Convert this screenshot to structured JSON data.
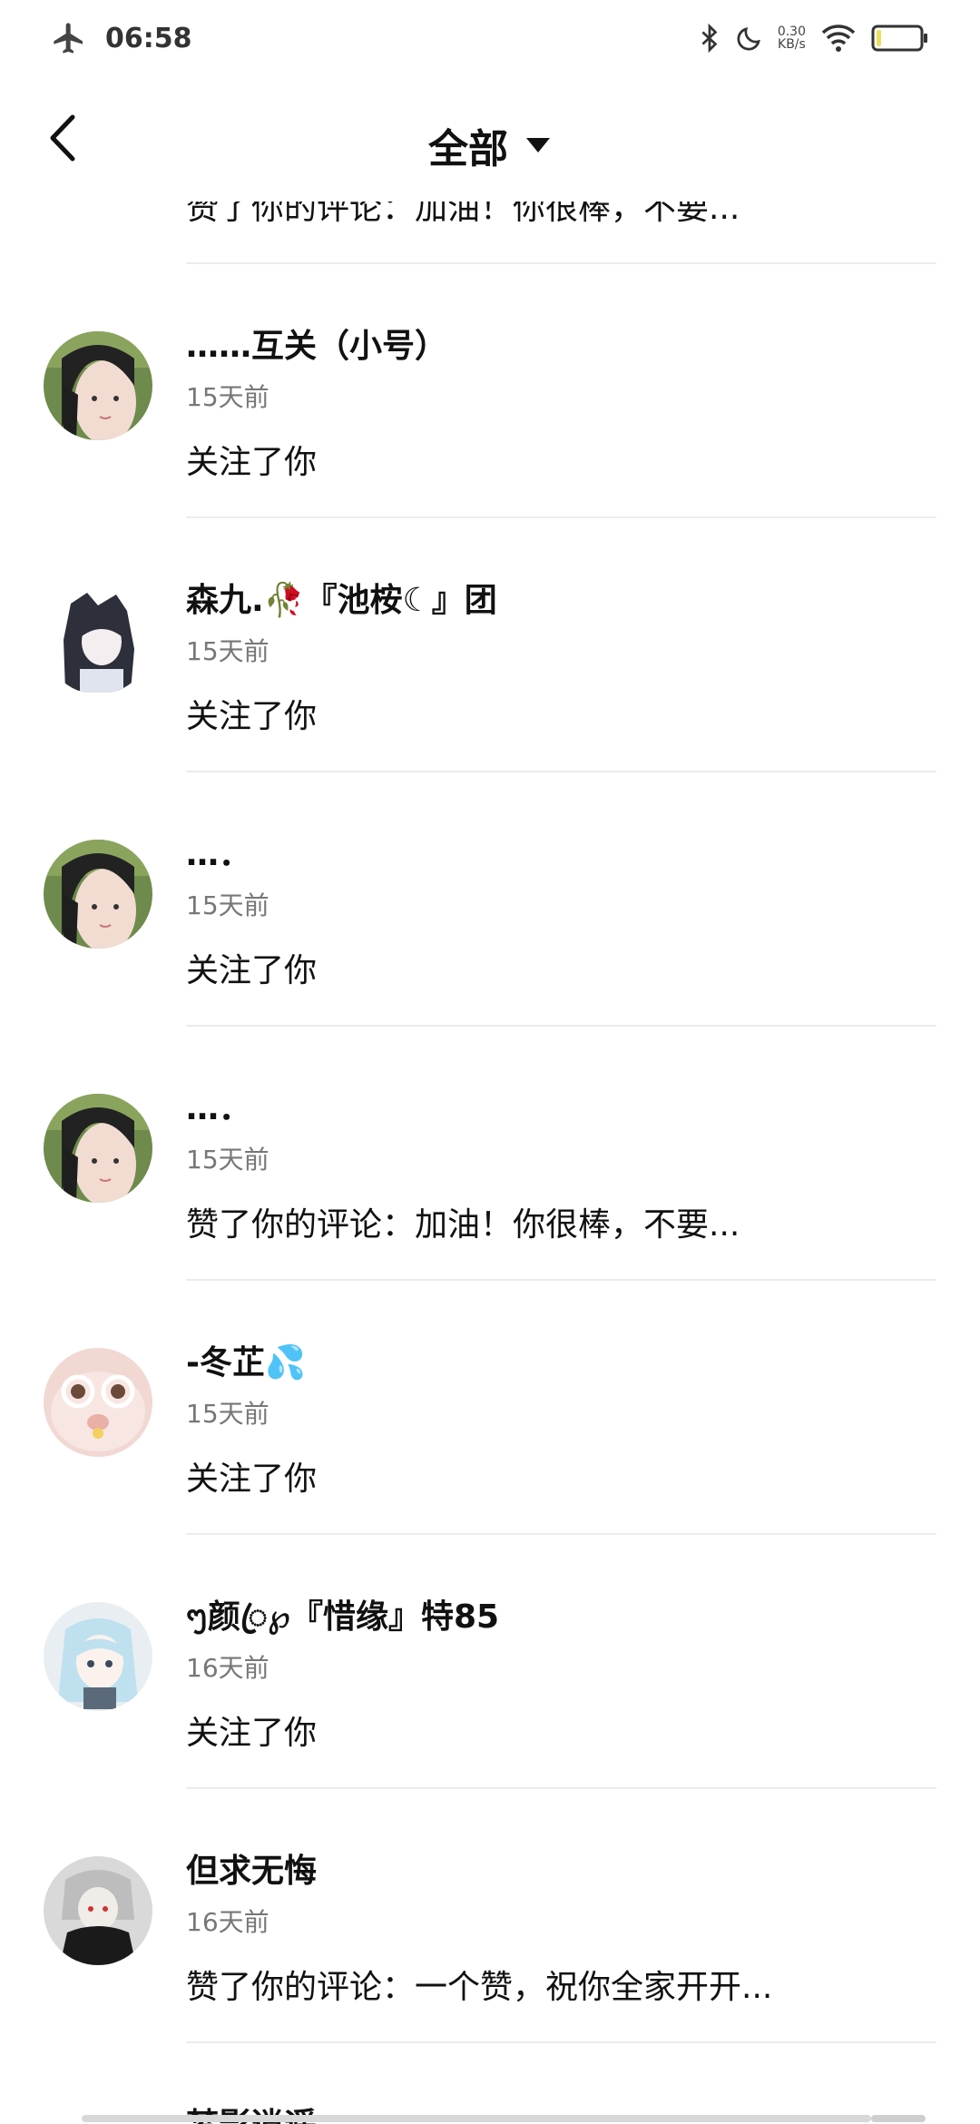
{
  "status_bar": {
    "time": "06:58",
    "speed_value": "0.30",
    "speed_unit": "KB/s",
    "icons": [
      "airplane-icon",
      "bluetooth-icon",
      "moon-icon",
      "wifi-icon",
      "battery-icon"
    ]
  },
  "header": {
    "title": "全部",
    "back_icon": "chevron-left-icon",
    "dropdown_icon": "caret-down-icon"
  },
  "partial_top": {
    "action": "赞了你的评论：加油！你很棒，不要..."
  },
  "items": [
    {
      "name": "……互关（小号）",
      "time": "15天前",
      "action": "关注了你",
      "avatar": "girl-photo"
    },
    {
      "name": "森九.🥀『池桉☾』团",
      "time": "15天前",
      "action": "关注了你",
      "avatar": "anime-dark"
    },
    {
      "name": "…．",
      "time": "15天前",
      "action": "关注了你",
      "avatar": "girl-photo"
    },
    {
      "name": "…．",
      "time": "15天前",
      "action": "赞了你的评论：加油！你很棒，不要...",
      "avatar": "girl-photo"
    },
    {
      "name": "-冬芷💦",
      "time": "15天前",
      "action": "关注了你",
      "avatar": "cat-glasses"
    },
    {
      "name": "ᪧ颜ꦿ℘『惜缘』特85",
      "time": "16天前",
      "action": "关注了你",
      "avatar": "anime-blue"
    },
    {
      "name": "但求无悔",
      "time": "16天前",
      "action": "赞了你的评论：一个赞，祝你全家开开...",
      "avatar": "anime-gray"
    }
  ],
  "partial_bottom": {
    "name": "梦影逍遥"
  },
  "colors": {
    "background": "#ffffff",
    "text_primary": "#111111",
    "text_secondary": "#777777",
    "divider": "#ececec"
  }
}
